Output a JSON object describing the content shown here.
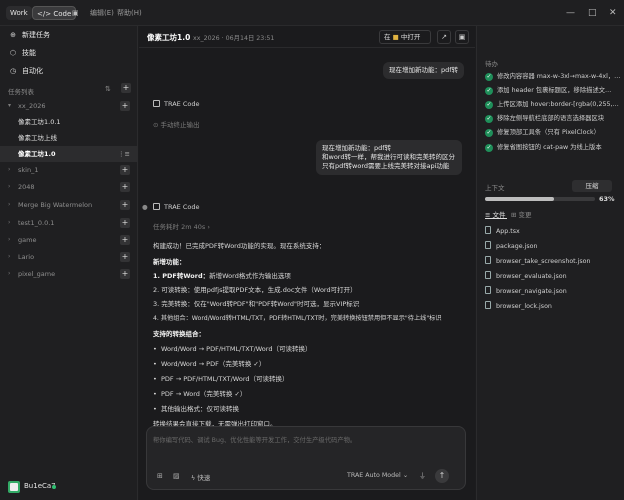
{
  "topbar": {
    "work_tab": "Work",
    "code_tab": "Code",
    "code_icon": "code-icon",
    "layout_icon": "panel-layout-icon",
    "menu": [
      "编辑(E)",
      "帮助(H)"
    ],
    "controls": [
      "—",
      "□",
      "✕"
    ]
  },
  "sidebar": {
    "new_task": "新建任务",
    "skills": "技能",
    "automation": "自动化",
    "task_list_label": "任务列表",
    "projects": [
      {
        "name": "xx_2026",
        "expanded": true
      },
      {
        "name": "skin_1",
        "expanded": false
      },
      {
        "name": "2048",
        "expanded": false
      },
      {
        "name": "Merge Big Watermelon",
        "expanded": false
      },
      {
        "name": "test1_0.0.1",
        "expanded": false
      },
      {
        "name": "game",
        "expanded": false
      },
      {
        "name": "Lario",
        "expanded": false
      },
      {
        "name": "pixel_game",
        "expanded": false
      }
    ],
    "tasks": [
      "像素工坊1.0.1",
      "像素工坊上线",
      "像素工坊1.0"
    ],
    "user": "Bu1eCa7"
  },
  "main": {
    "title": "像素工坊1.0",
    "subtitle": "xx_2026 · 06月14日 23:51",
    "open_in_prefix": "在",
    "open_in_label": "中打开",
    "user_msg_1": "现在增加新功能：pdf转",
    "agent_name": "TRAE Code",
    "stopped": "手动终止输出",
    "user_msg_2": [
      "现在增加新功能：pdf转",
      "和word转一样，帮我进行可读和完美转的区分",
      "只有pdf转word需要上线完美转对接api功能"
    ],
    "task_time": "任务耗时 2m 40s",
    "content": {
      "intro": "构建成功！已完成PDF转Word功能的实现。现在系统支持：",
      "new_features": "新增功能：",
      "f1_bold": "1. PDF转Word：",
      "f1_rest": "新增Word格式作为输出选项",
      "f2": "2. 可读转换：使用pdfjs提取PDF文本，生成.doc文件（Word可打开）",
      "f3": "3. 完美转换：仅在\"Word转PDF\"和\"PDF转Word\"时可选，显示VIP标识",
      "f4": "4. 其他组合：Word/Word转HTML/TXT，PDF转HTML/TXT时，完美转换按钮禁用但不显示\"待上线\"标识",
      "supported": "支持的转换组合：",
      "combos": [
        "Word/Word → PDF/HTML/TXT/Word（可读转换）",
        "Word/Word → PDF（完美转换 ✓）",
        "PDF → PDF/HTML/TXT/Word（可读转换）",
        "PDF → Word（完美转换 ✓）",
        "其他输出格式：仅可读转换"
      ],
      "last": "转换结果会直接下载，无需弹出打印窗口。"
    },
    "composer": {
      "placeholder": "帮你编写代码、调试 Bug、优化性能等开发工作，交付生产级代码产物。",
      "speed": "快速",
      "model": "TRAE Auto Model"
    }
  },
  "right": {
    "todo_label": "待办",
    "todos": [
      "修改内容容器 max-w-3xl→max-w-4xl，…",
      "添加 header 包裹标题区，移除描述文…",
      "上传区添加 hover:border-[rgba(0,255,…",
      "移除左侧导航栏底部的语言选择器区块",
      "修复顶部工具条（只有 PixelClock）",
      "修复省图按钮的 cat-paw 为线上版本"
    ],
    "context_label": "上下文",
    "compress": "压缩",
    "progress_pct": "63%",
    "progress_value": 0.63,
    "files_tab": "文件",
    "changes_tab": "变更",
    "files": [
      "App.tsx",
      "package.json",
      "browser_take_screenshot.json",
      "browser_evaluate.json",
      "browser_navigate.json",
      "browser_lock.json"
    ]
  },
  "colors": {
    "accent_green": "#1f8f5a",
    "bg": "#1c1c1e"
  }
}
